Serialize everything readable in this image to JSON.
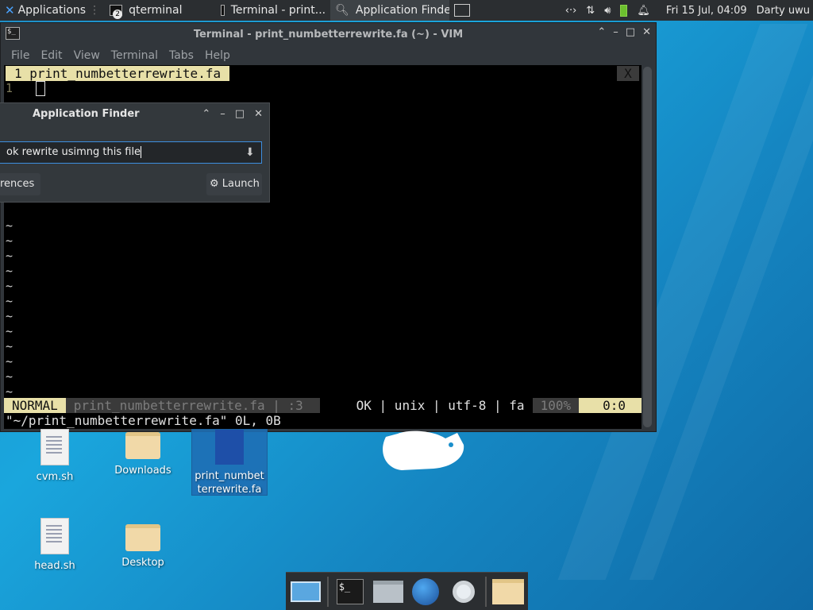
{
  "panel": {
    "applications": "Applications",
    "qterminal_badge": "2",
    "qterminal": "qterminal",
    "terminal_task": "Terminal - print...",
    "finder_task": "Application Finder",
    "datetime": "Fri 15 Jul, 04:09",
    "user": "Darty uwu"
  },
  "terminal": {
    "title": "Terminal - print_numbetterrewrite.fa (~) - VIM",
    "menu": [
      "File",
      "Edit",
      "View",
      "Terminal",
      "Tabs",
      "Help"
    ],
    "vim": {
      "tab_label": "1 print_numbetterrewrite.fa",
      "close_x": "X",
      "line_number": "1",
      "tilde": "~",
      "mode": "NORMAL",
      "file_status": "print_numbetterrewrite.fa | :3",
      "file_info": "OK | unix | utf-8 | fa",
      "percent": "100%",
      "position": "0:0",
      "command_line": "\"~/print_numbetterrewrite.fa\" 0L, 0B"
    }
  },
  "finder": {
    "title": "Application Finder",
    "input_value": "ok rewrite usimng this file",
    "prefs_label": "rences",
    "launch_label": "Launch"
  },
  "desktop": {
    "icons": [
      {
        "label": "cvm.sh"
      },
      {
        "label": "Downloads"
      },
      {
        "label": "print_numbet terrewrite.fa"
      },
      {
        "label": "head.sh"
      },
      {
        "label": "Desktop"
      }
    ]
  },
  "colors": {
    "accent": "#3d8ee0",
    "vim_highlight": "#e8e0a8",
    "panel_bg": "#2b2e31"
  }
}
